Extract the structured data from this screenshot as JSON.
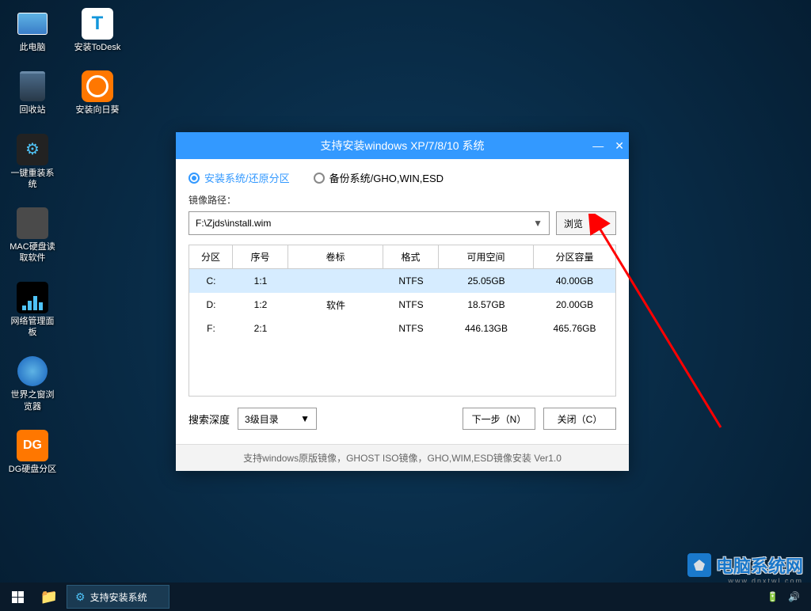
{
  "desktop": {
    "icons": [
      {
        "name": "this-pc",
        "label": "此电脑"
      },
      {
        "name": "install-todesk",
        "label": "安装ToDesk"
      },
      {
        "name": "recycle-bin",
        "label": "回收站"
      },
      {
        "name": "install-sunlogin",
        "label": "安装向日葵"
      },
      {
        "name": "reinstall-system",
        "label": "一键重装系统"
      },
      {
        "name": "mac-disk-reader",
        "label": "MAC硬盘读取软件"
      },
      {
        "name": "network-panel",
        "label": "网络管理面板"
      },
      {
        "name": "world-browser",
        "label": "世界之窗浏览器"
      },
      {
        "name": "dg-partition",
        "label": "DG硬盘分区"
      }
    ]
  },
  "dialog": {
    "title": "支持安装windows XP/7/8/10 系统",
    "radio_install": "安装系统/还原分区",
    "radio_backup": "备份系统/GHO,WIN,ESD",
    "image_path_label": "镜像路径：",
    "image_path_value": "F:\\Zjds\\install.wim",
    "browse_button": "浏览（B）",
    "table": {
      "headers": {
        "partition": "分区",
        "index": "序号",
        "volume": "卷标",
        "format": "格式",
        "free": "可用空间",
        "capacity": "分区容量"
      },
      "rows": [
        {
          "partition": "C:",
          "index": "1:1",
          "volume": "",
          "format": "NTFS",
          "free": "25.05GB",
          "capacity": "40.00GB",
          "selected": true
        },
        {
          "partition": "D:",
          "index": "1:2",
          "volume": "软件",
          "format": "NTFS",
          "free": "18.57GB",
          "capacity": "20.00GB",
          "selected": false
        },
        {
          "partition": "F:",
          "index": "2:1",
          "volume": "",
          "format": "NTFS",
          "free": "446.13GB",
          "capacity": "465.76GB",
          "selected": false
        }
      ]
    },
    "search_depth_label": "搜索深度",
    "search_depth_value": "3级目录",
    "next_button": "下一步（N）",
    "close_button": "关闭（C）",
    "footer_note": "支持windows原版镜像，GHOST ISO镜像，GHO,WIM,ESD镜像安装 Ver1.0"
  },
  "taskbar": {
    "task_label": "支持安装系统"
  },
  "watermark": {
    "text": "电脑系统网",
    "url": "www.dnxtwl.com"
  }
}
